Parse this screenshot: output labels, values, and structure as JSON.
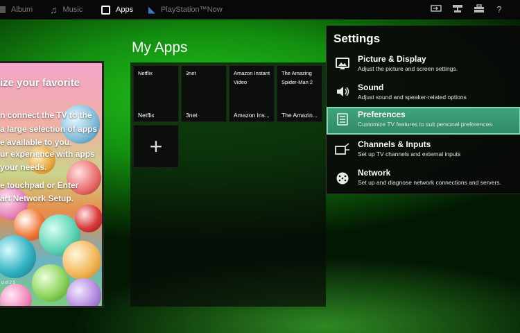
{
  "topbar": {
    "tabs": [
      {
        "label": "Album",
        "icon": "album-icon"
      },
      {
        "label": "Music",
        "icon": "music-icon"
      },
      {
        "label": "Apps",
        "icon": "apps-icon"
      },
      {
        "label": "PlayStation™Now",
        "icon": "playstation-icon"
      }
    ],
    "active_tab": "Apps",
    "right_icons": [
      "input-icon",
      "network-icon",
      "toolbox-icon",
      "help-icon"
    ],
    "help_glyph": "?"
  },
  "promo": {
    "title": "ize your favorite",
    "lines": [
      "n connect the TV to the",
      "a large selection of apps",
      "e available to you.",
      "ur experience with apps",
      "your needs.",
      "e touchpad or Enter",
      "art Network Setup."
    ],
    "footer": "d of 2 5"
  },
  "my_apps": {
    "title": "My Apps",
    "tiles": [
      {
        "name": "Netflix",
        "label": "Netflix"
      },
      {
        "name": "3net",
        "label": "3net"
      },
      {
        "name": "Amazon Instant Video",
        "label": "Amazon Ins..."
      },
      {
        "name": "The Amazing Spider-Man 2",
        "label": "The Amazin..."
      }
    ],
    "add_glyph": "+"
  },
  "settings": {
    "title": "Settings",
    "items": [
      {
        "label": "Picture & Display",
        "desc": "Adjust the picture and screen settings.",
        "icon": "picture-display-icon"
      },
      {
        "label": "Sound",
        "desc": "Adjust sound and speaker-related options",
        "icon": "sound-icon"
      },
      {
        "label": "Preferences",
        "desc": "Customize TV features to suit personal preferences.",
        "icon": "preferences-icon"
      },
      {
        "label": "Channels & Inputs",
        "desc": "Set up TV channels and external inputs",
        "icon": "channels-inputs-icon"
      },
      {
        "label": "Network",
        "desc": "Set up and diagnose network connections and servers.",
        "icon": "network-globe-icon"
      }
    ],
    "selected": "Preferences"
  },
  "colors": {
    "background_green": "#22c41a",
    "selected_row": "#41a37d",
    "selected_border": "#7fd9b2"
  }
}
